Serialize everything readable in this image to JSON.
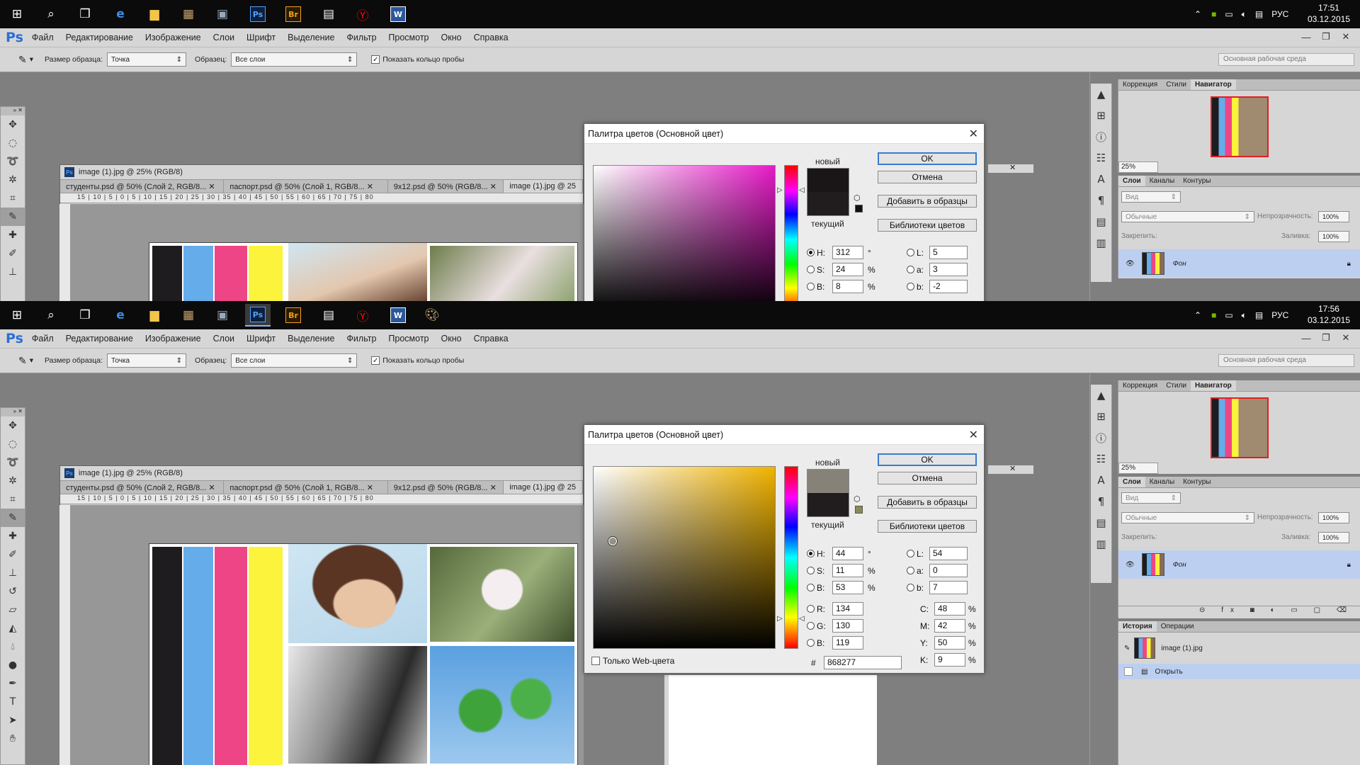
{
  "top": {
    "clock_time": "17:51",
    "clock_date": "03.12.2015",
    "lang": "РУС",
    "dialog_title": "Палитра цветов (Основной цвет)",
    "new_label": "новый",
    "current_label": "текущий",
    "ok": "OK",
    "cancel": "Отмена",
    "add_swatch": "Добавить в образцы",
    "color_libs": "Библиотеки цветов",
    "H": "312",
    "S": "24",
    "B": "8",
    "L": "5",
    "a": "3",
    "b": "-2",
    "new_color": "#1a1617",
    "current_color": "#211d1f",
    "hue_color": "#e61ac8",
    "nav_zoom": "25%"
  },
  "bottom": {
    "clock_time": "17:56",
    "clock_date": "03.12.2015",
    "lang": "РУС",
    "dialog_title": "Палитра цветов (Основной цвет)",
    "new_label": "новый",
    "current_label": "текущий",
    "ok": "OK",
    "cancel": "Отмена",
    "add_swatch": "Добавить в образцы",
    "color_libs": "Библиотеки цветов",
    "H": "44",
    "S": "11",
    "B": "53",
    "L": "54",
    "a": "0",
    "b": "7",
    "R": "134",
    "G": "130",
    "Bv": "119",
    "C": "48",
    "M": "42",
    "Y": "50",
    "K": "9",
    "hex": "868277",
    "web_only": "Только Web-цвета",
    "new_color": "#868277",
    "current_color": "#211d1f",
    "hue_color": "#f0b300",
    "nav_zoom": "25%",
    "history_tab": "История",
    "actions_tab": "Операции",
    "history_file": "image (1).jpg",
    "history_open": "Открыть"
  },
  "menu": [
    "Файл",
    "Редактирование",
    "Изображение",
    "Слои",
    "Шрифт",
    "Выделение",
    "Фильтр",
    "Просмотр",
    "Окно",
    "Справка"
  ],
  "options": {
    "sample_size_label": "Размер образца:",
    "sample_size_value": "Точка",
    "sample_label": "Образец:",
    "sample_value": "Все слои",
    "show_ring": "Показать кольцо пробы",
    "workspace": "Основная рабочая среда"
  },
  "doc": {
    "title": "image (1).jpg @ 25% (RGB/8)",
    "tabs": [
      "студенты.psd @ 50% (Слой 2, RGB/8...",
      "паспорт.psd @ 50% (Слой 1, RGB/8...",
      "9x12.psd @ 50% (RGB/8...",
      "image (1).jpg @ 25"
    ]
  },
  "panels": {
    "tab_correction": "Коррекция",
    "tab_styles": "Стили",
    "tab_navigator": "Навигатор",
    "tab_layers": "Слои",
    "tab_channels": "Каналы",
    "tab_paths": "Контуры",
    "kind": "Вид",
    "blend": "Обычные",
    "opacity_label": "Непрозрачность:",
    "opacity": "100%",
    "lock_label": "Закрепить:",
    "fill_label": "Заливка:",
    "fill": "100%",
    "layer_name": "Фон"
  }
}
